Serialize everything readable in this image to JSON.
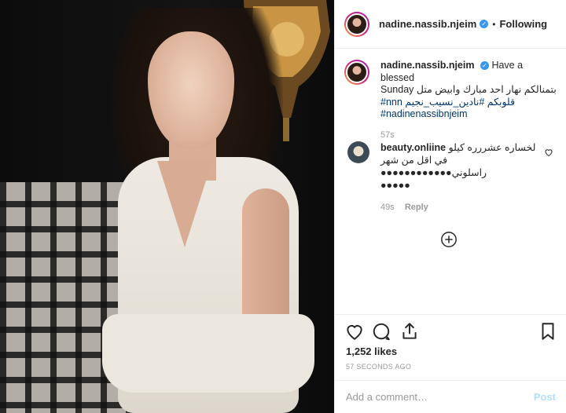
{
  "post": {
    "username": "nadine.nassib.njeim",
    "follow_state": "Following",
    "caption": {
      "username": "nadine.nassib.njeim",
      "text_line1": "Have a blessed",
      "text_line2": "Sunday بتمنالكم نهار احد مبارك وابيض متل",
      "hashtags_line1": "#nnn قلوبكم #نادين_نسيب_نجيم",
      "hashtags_line2": "#nadinenassibnjeim",
      "time": "57s"
    },
    "comment": {
      "username": "beauty.onliine",
      "line1": "لخساره عشررره كيلو",
      "line2": "في اقل من شهر",
      "line3": "●●●●●●●●●●●●راسلوني",
      "line4": "●●●●●",
      "time": "49s",
      "reply_label": "Reply"
    },
    "likes": "1,252 likes",
    "posted_ago": "57 SECONDS AGO",
    "add_comment_placeholder": "Add a comment…",
    "post_label": "Post"
  },
  "colors": {
    "link": "#003569",
    "verified": "#3897f0",
    "post_disabled": "#b2dffc",
    "meta": "#999999"
  },
  "icons": {
    "like": "heart-icon",
    "comment": "comment-icon",
    "share": "share-icon",
    "save": "bookmark-icon",
    "load_more": "plus-circle-icon"
  }
}
